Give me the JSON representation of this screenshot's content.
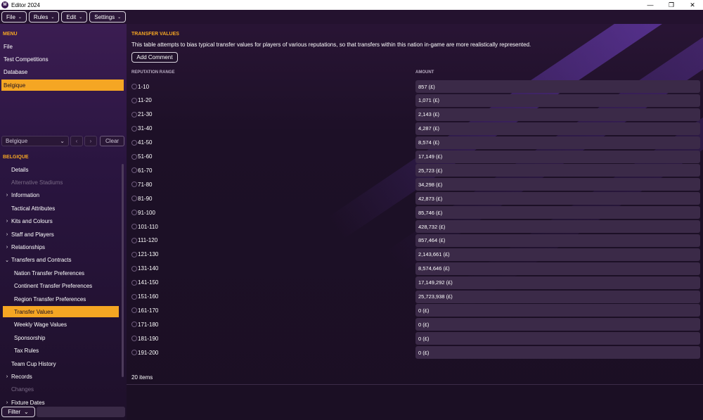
{
  "window": {
    "title": "Editor 2024",
    "app_icon_letter": "M"
  },
  "topbar": [
    {
      "label": "File"
    },
    {
      "label": "Rules"
    },
    {
      "label": "Edit"
    },
    {
      "label": "Settings"
    }
  ],
  "sidebar": {
    "menu_heading": "MENU",
    "menu_items": [
      "File",
      "Test Competitions",
      "Database",
      "Belgique"
    ],
    "selector": {
      "value": "Belgique",
      "clear_label": "Clear"
    },
    "section_heading": "BELGIQUE",
    "nav": [
      {
        "label": "Details",
        "level": 1,
        "expander": ""
      },
      {
        "label": "Alternative Stadiums",
        "level": 1,
        "expander": "",
        "disabled": true
      },
      {
        "label": "Information",
        "level": 1,
        "expander": "›"
      },
      {
        "label": "Tactical Attributes",
        "level": 1,
        "expander": ""
      },
      {
        "label": "Kits and Colours",
        "level": 1,
        "expander": "›"
      },
      {
        "label": "Staff and Players",
        "level": 1,
        "expander": "›"
      },
      {
        "label": "Relationships",
        "level": 1,
        "expander": "›"
      },
      {
        "label": "Transfers and Contracts",
        "level": 1,
        "expander": "⌄"
      },
      {
        "label": "Nation Transfer Preferences",
        "level": 2,
        "expander": ""
      },
      {
        "label": "Continent Transfer Preferences",
        "level": 2,
        "expander": ""
      },
      {
        "label": "Region Transfer Preferences",
        "level": 2,
        "expander": ""
      },
      {
        "label": "Transfer Values",
        "level": 2,
        "expander": "",
        "selected": true
      },
      {
        "label": "Weekly Wage Values",
        "level": 2,
        "expander": ""
      },
      {
        "label": "Sponsorship",
        "level": 2,
        "expander": ""
      },
      {
        "label": "Tax Rules",
        "level": 2,
        "expander": ""
      },
      {
        "label": "Team Cup History",
        "level": 1,
        "expander": ""
      },
      {
        "label": "Records",
        "level": 1,
        "expander": "›"
      },
      {
        "label": "Changes",
        "level": 1,
        "expander": "",
        "disabled": true
      },
      {
        "label": "Fixture Dates",
        "level": 1,
        "expander": "›"
      }
    ],
    "filter_label": "Filter"
  },
  "main": {
    "title": "TRANSFER VALUES",
    "description": "This table attempts to bias typical transfer values for players of various reputations, so that transfers within this nation in-game are more realistically represented.",
    "add_comment_label": "Add Comment",
    "columns": {
      "range": "REPUTATION RANGE",
      "amount": "AMOUNT"
    },
    "rows": [
      {
        "range": "1-10",
        "amount": "857 (£)"
      },
      {
        "range": "11-20",
        "amount": "1,071 (£)"
      },
      {
        "range": "21-30",
        "amount": "2,143 (£)"
      },
      {
        "range": "31-40",
        "amount": "4,287 (£)"
      },
      {
        "range": "41-50",
        "amount": "8,574 (£)"
      },
      {
        "range": "51-60",
        "amount": "17,149 (£)"
      },
      {
        "range": "61-70",
        "amount": "25,723 (£)"
      },
      {
        "range": "71-80",
        "amount": "34,298 (£)"
      },
      {
        "range": "81-90",
        "amount": "42,873 (£)"
      },
      {
        "range": "91-100",
        "amount": "85,746 (£)"
      },
      {
        "range": "101-110",
        "amount": "428,732 (£)"
      },
      {
        "range": "111-120",
        "amount": "857,464 (£)"
      },
      {
        "range": "121-130",
        "amount": "2,143,661 (£)"
      },
      {
        "range": "131-140",
        "amount": "8,574,646 (£)"
      },
      {
        "range": "141-150",
        "amount": "17,149,292 (£)"
      },
      {
        "range": "151-160",
        "amount": "25,723,938 (£)"
      },
      {
        "range": "161-170",
        "amount": "0 (£)"
      },
      {
        "range": "171-180",
        "amount": "0 (£)"
      },
      {
        "range": "181-190",
        "amount": "0 (£)"
      },
      {
        "range": "191-200",
        "amount": "0 (£)"
      }
    ],
    "items_count": "20 items"
  },
  "colors": {
    "accent": "#f5a623",
    "background": "#1c1025",
    "row_fill": "#3b2a48"
  }
}
